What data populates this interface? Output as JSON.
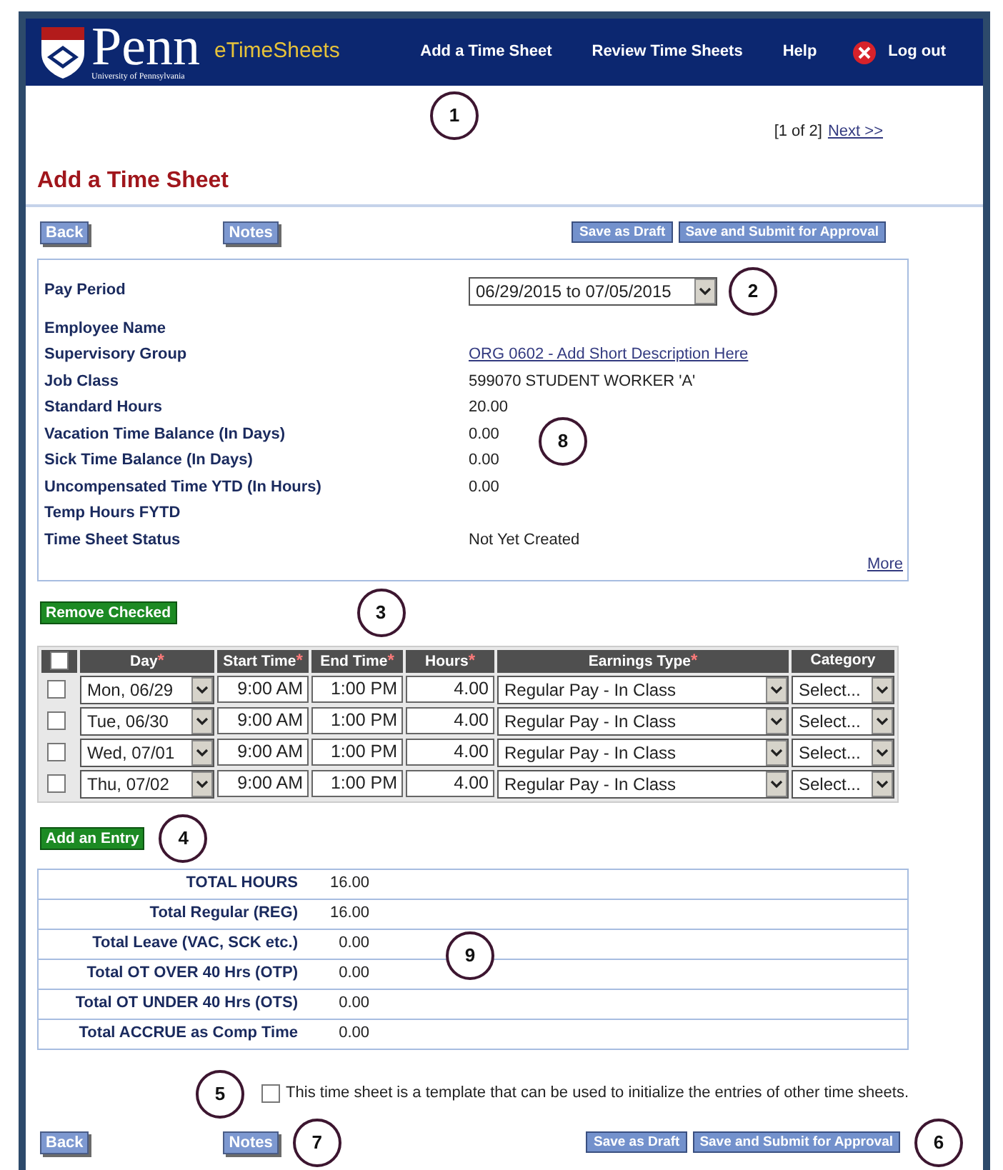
{
  "header": {
    "logo_text": "Penn",
    "logo_subtext": "University of Pennsylvania",
    "app_name": "eTimeSheets",
    "nav": [
      {
        "label": "Add a Time Sheet",
        "kind": "link"
      },
      {
        "label": "Review Time Sheets",
        "kind": "link"
      },
      {
        "label": "Help",
        "kind": "link"
      },
      {
        "label": "Log out",
        "kind": "logout"
      }
    ],
    "callout": "1"
  },
  "pager": {
    "text": "[1 of 2]",
    "link": "Next >>"
  },
  "title": "Add a Time Sheet",
  "top_buttons": [
    {
      "label": "Back",
      "kind": "nav"
    },
    {
      "label": "Notes",
      "kind": "nav"
    },
    {
      "label": "Save as Draft",
      "kind": "action"
    },
    {
      "label": "Save and Submit for Approval",
      "kind": "action"
    }
  ],
  "info": {
    "callout": "8",
    "rows": [
      {
        "label": "Pay Period",
        "kind": "select",
        "value": "06/29/2015 to 07/05/2015",
        "callout": "2"
      },
      {
        "label": "Employee Name",
        "kind": "text"
      },
      {
        "label": "Supervisory Group",
        "kind": "link",
        "value": "ORG 0602 - Add Short Description Here"
      },
      {
        "label": "Job Class",
        "kind": "text",
        "value": "599070 STUDENT WORKER 'A'"
      },
      {
        "label": "Standard Hours",
        "kind": "text",
        "value": "20.00"
      },
      {
        "label": "Vacation Time Balance (In Days)",
        "kind": "text",
        "value": "0.00"
      },
      {
        "label": "Sick Time Balance (In Days)",
        "kind": "text",
        "value": "0.00"
      },
      {
        "label": "Uncompensated Time YTD (In Hours)",
        "kind": "text",
        "value": "0.00"
      },
      {
        "label": "Temp Hours FYTD",
        "kind": "text"
      },
      {
        "label": "Time Sheet Status",
        "kind": "text",
        "value": "Not Yet Created"
      }
    ],
    "more": "More"
  },
  "remove_button": {
    "label": "Remove Checked",
    "callout": "3"
  },
  "entries": {
    "all_checked": false,
    "columns": [
      {
        "label": "Day",
        "mark": "*"
      },
      {
        "label": "Start Time",
        "mark": "*"
      },
      {
        "label": "End Time",
        "mark": "*"
      },
      {
        "label": "Hours",
        "mark": "*"
      },
      {
        "label": "Earnings Type",
        "mark": "*"
      },
      {
        "label": "Category"
      }
    ],
    "rows": [
      {
        "checked": false,
        "day": "Mon, 06/29",
        "start": "9:00 AM",
        "end": "1:00 PM",
        "hours": "4.00",
        "earnings": "Regular Pay - In Class",
        "category": "Select..."
      },
      {
        "checked": false,
        "day": "Tue, 06/30",
        "start": "9:00 AM",
        "end": "1:00 PM",
        "hours": "4.00",
        "earnings": "Regular Pay - In Class",
        "category": "Select..."
      },
      {
        "checked": false,
        "day": "Wed, 07/01",
        "start": "9:00 AM",
        "end": "1:00 PM",
        "hours": "4.00",
        "earnings": "Regular Pay - In Class",
        "category": "Select..."
      },
      {
        "checked": false,
        "day": "Thu, 07/02",
        "start": "9:00 AM",
        "end": "1:00 PM",
        "hours": "4.00",
        "earnings": "Regular Pay - In Class",
        "category": "Select..."
      }
    ]
  },
  "add_button": {
    "label": "Add an Entry",
    "callout": "4"
  },
  "totals": {
    "callout": "9",
    "rows": [
      {
        "label": "TOTAL HOURS",
        "value": "16.00"
      },
      {
        "label": "Total Regular (REG)",
        "value": "16.00"
      },
      {
        "label": "Total Leave (VAC, SCK etc.)",
        "value": "0.00"
      },
      {
        "label": "Total OT OVER 40 Hrs (OTP)",
        "value": "0.00"
      },
      {
        "label": "Total OT UNDER 40 Hrs (OTS)",
        "value": "0.00"
      },
      {
        "label": "Total ACCRUE as Comp Time",
        "value": "0.00"
      }
    ]
  },
  "template": {
    "checked": false,
    "label": "This time sheet is a template that can be used to initialize the entries of other time sheets.",
    "callout": "5"
  },
  "bottom_buttons": [
    {
      "label": "Back",
      "kind": "nav"
    },
    {
      "label": "Notes",
      "kind": "nav",
      "callout": "7"
    },
    {
      "label": "Save as Draft",
      "kind": "action"
    },
    {
      "label": "Save and Submit for Approval",
      "kind": "action",
      "callout": "6"
    }
  ]
}
